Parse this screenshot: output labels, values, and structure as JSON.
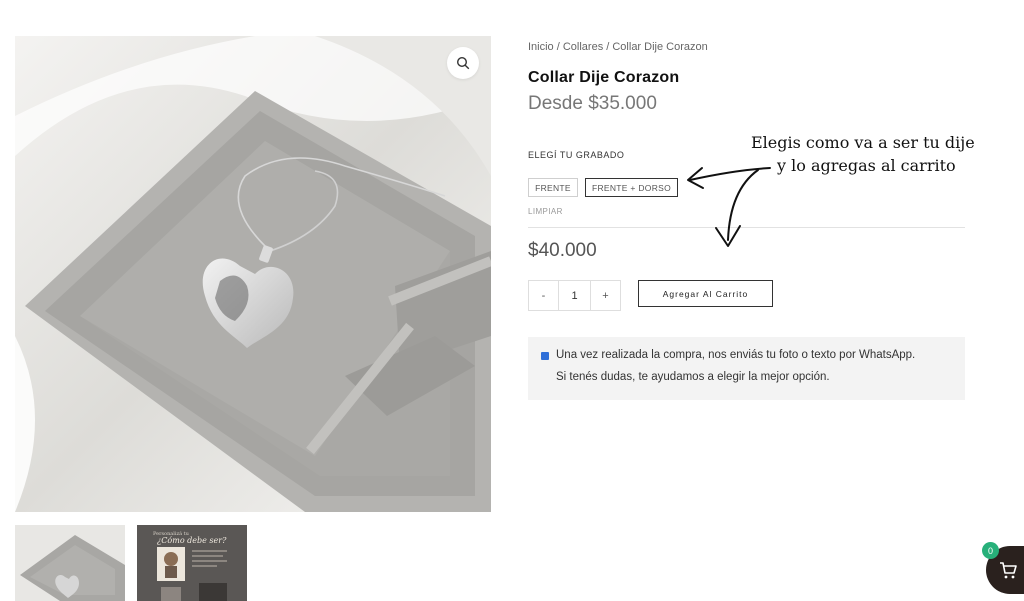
{
  "breadcrumb": "Inicio / Collares / Collar Dije Corazon",
  "product": {
    "title": "Collar Dije Corazon",
    "price_from": "Desde $35.000",
    "price": "$40.000"
  },
  "options": {
    "label": "ELEGÍ TU GRABADO",
    "items": [
      "FRENTE",
      "FRENTE + DORSO"
    ],
    "selected": "FRENTE + DORSO",
    "clear_label": "LIMPIAR"
  },
  "quantity": {
    "minus": "-",
    "value": "1",
    "plus": "+"
  },
  "add_to_cart": "Agregar Al Carrito",
  "notice": {
    "line1": "Una vez realizada la compra, nos enviás tu foto o texto por WhatsApp.",
    "line2": "Si tenés dudas, te ayudamos a elegir la mejor opción."
  },
  "annotation": {
    "line1": "Elegis como va a ser tu dije",
    "line2": "y lo agregas al carrito"
  },
  "thumbnail2": {
    "small": "Personalizá tu",
    "title": "¿Cómo debe ser?"
  },
  "cart": {
    "count": "0"
  },
  "colors": {
    "accent_dark": "#2a211e",
    "badge": "#27b07a",
    "info_icon": "#2f6fd8"
  },
  "icons": [
    "zoom-icon",
    "info-icon",
    "cart-icon"
  ]
}
